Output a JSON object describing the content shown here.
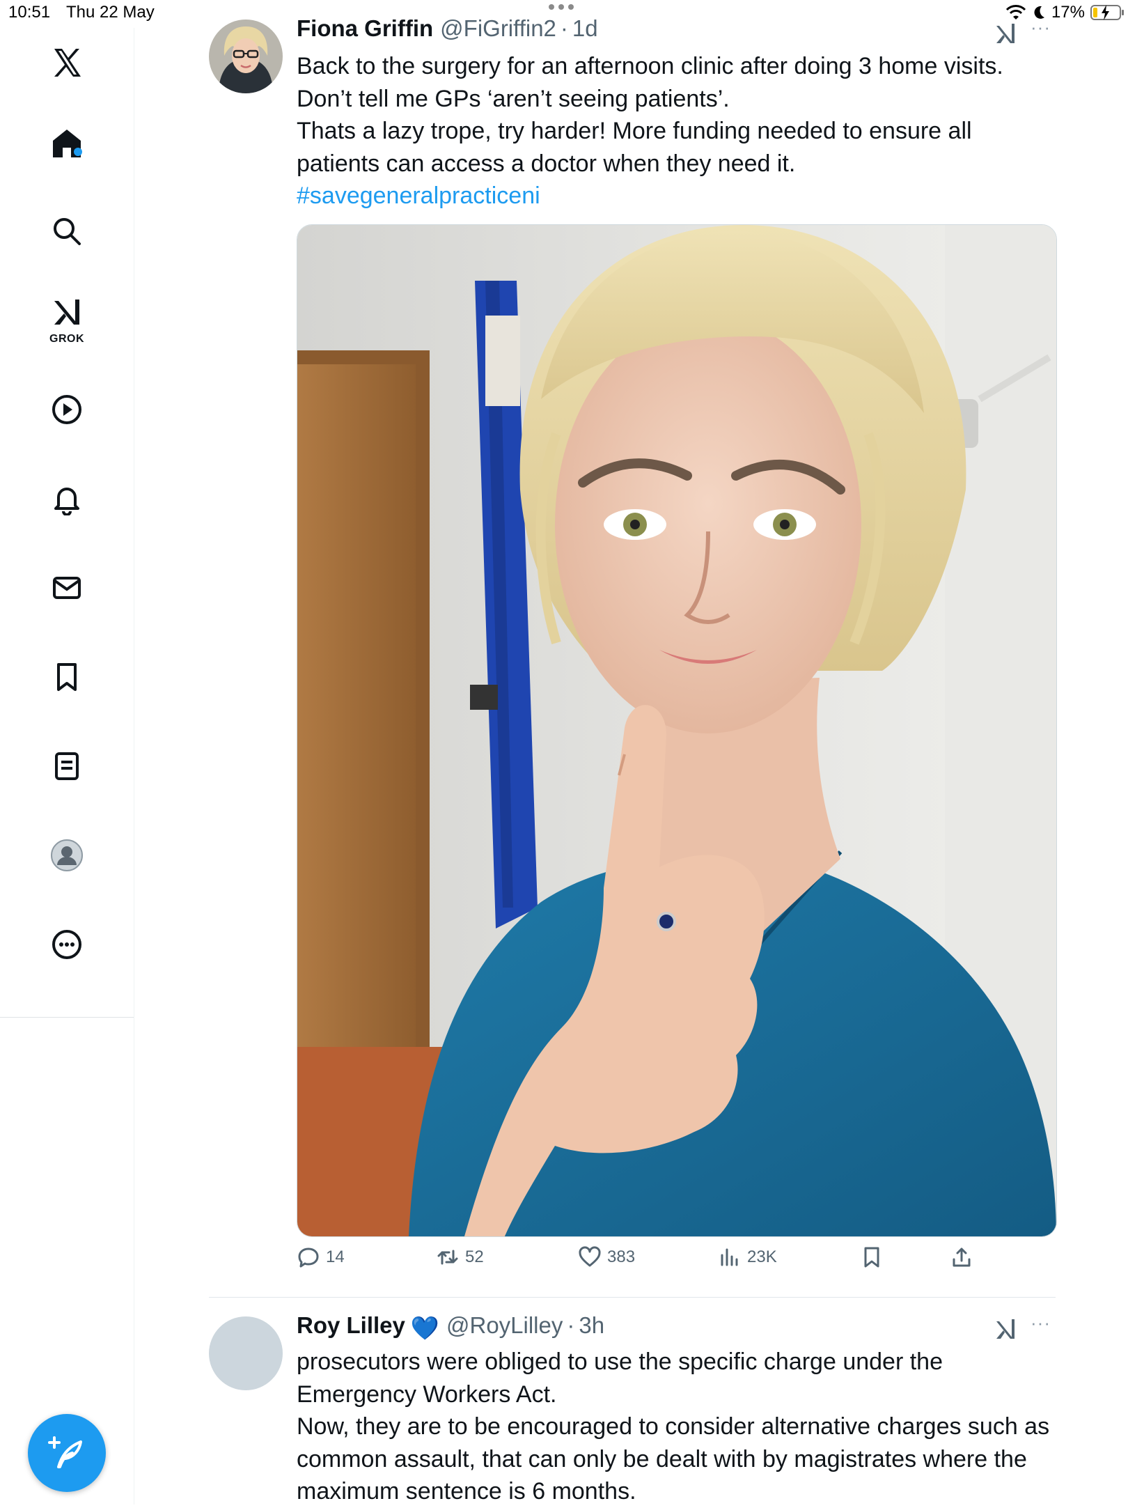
{
  "status_bar": {
    "time": "10:51",
    "date": "Thu 22 May",
    "battery": "17%",
    "battery_level": 0.17
  },
  "sidebar": {
    "logo": "x-logo-icon",
    "items": [
      {
        "name": "home",
        "icon": "home-icon",
        "has_notification_dot": true
      },
      {
        "name": "explore",
        "icon": "search-icon"
      },
      {
        "name": "grok",
        "icon": "grok-icon",
        "label": "GROK"
      },
      {
        "name": "video",
        "icon": "play-circle-icon"
      },
      {
        "name": "notifications",
        "icon": "bell-icon"
      },
      {
        "name": "messages",
        "icon": "envelope-icon"
      },
      {
        "name": "bookmarks",
        "icon": "bookmark-icon"
      },
      {
        "name": "lists",
        "icon": "list-icon"
      },
      {
        "name": "profile",
        "icon": "profile-icon"
      },
      {
        "name": "more",
        "icon": "more-circle-icon"
      }
    ],
    "compose_icon": "compose-feather-icon"
  },
  "tweets": [
    {
      "author_name": "Fiona Griffin",
      "handle": "@FiGriffin2",
      "separator": "·",
      "time": "1d",
      "text_lines": [
        "Back to the surgery for an afternoon clinic after doing 3 home visits.",
        "Don’t tell me GPs ‘aren’t seeing patients’.",
        "Thats a lazy trope, try harder! More funding needed to ensure all",
        "patients can access a doctor when they need it."
      ],
      "hashtag": "#savegeneralpracticeni",
      "media": "selfie-photo",
      "stats": {
        "replies": "14",
        "reposts": "52",
        "likes": "383",
        "views": "23K"
      }
    },
    {
      "author_name": "Roy Lilley",
      "verified_emoji": "💙",
      "handle": "@RoyLilley",
      "separator": "·",
      "time": "3h",
      "text_lines": [
        "prosecutors were obliged to use the specific charge under the",
        "Emergency Workers Act.",
        "Now, they are to be encouraged to consider alternative charges such as",
        "common assault, that can only be dealt with by magistrates where the",
        "maximum sentence is 6 months."
      ]
    }
  ],
  "more_label": "···",
  "colors": {
    "accent": "#1d9bf0",
    "text": "#0f1419",
    "muted": "#536471"
  }
}
